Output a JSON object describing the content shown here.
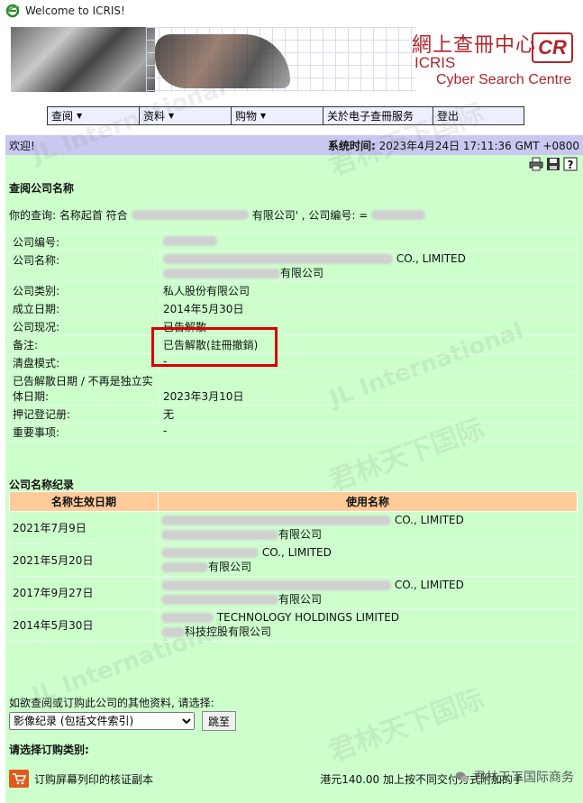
{
  "window": {
    "title": "Welcome to ICRIS!"
  },
  "banner": {
    "cn_logo": "網上查冊中心",
    "cr_mark": "CR",
    "icris": "ICRIS",
    "subtitle": "Cyber Search Centre"
  },
  "menu": [
    {
      "label": "查阅",
      "dropdown": true
    },
    {
      "label": "资料",
      "dropdown": true
    },
    {
      "label": "购物",
      "dropdown": true
    },
    {
      "label": "关於电子查冊服务",
      "dropdown": false
    },
    {
      "label": "登出",
      "dropdown": false
    }
  ],
  "welcome": {
    "greeting": "欢迎!",
    "time_label": "系统时间:",
    "time_value": "2023年4月24日 17:11:36 GMT +0800"
  },
  "search": {
    "title": "查阅公司名称",
    "query_prefix": "你的查询:  名称起首 符合",
    "query_suffix": "有限公司' , 公司编号:  ="
  },
  "company": {
    "rows": [
      {
        "label": "公司编号:",
        "value": ""
      },
      {
        "label": "公司名称:",
        "value": "CO., LIMITED",
        "value2": "有限公司"
      },
      {
        "label": "公司类别:",
        "value": "私人股份有限公司"
      },
      {
        "label": "成立日期:",
        "value": "2014年5月30日"
      },
      {
        "label": "公司现况:",
        "value": "已告解散"
      },
      {
        "label": "备注:",
        "value": "已告解散(註冊撤銷)"
      },
      {
        "label": "清盘模式:",
        "value": "-"
      },
      {
        "label": "已告解散日期 / 不再是独立实体日期:",
        "value": "2023年3月10日"
      },
      {
        "label": "押记登记册:",
        "value": "无"
      },
      {
        "label": "重要事项:",
        "value": "-"
      }
    ]
  },
  "history": {
    "title": "公司名称纪录",
    "headers": [
      "名称生效日期",
      "使用名称"
    ],
    "rows": [
      {
        "date": "2021年7月9日",
        "en": "CO., LIMITED",
        "cn": "有限公司"
      },
      {
        "date": "2021年5月20日",
        "en": "CO., LIMITED",
        "cn": "有限公司"
      },
      {
        "date": "2017年9月27日",
        "en": "CO., LIMITED",
        "cn": "有限公司"
      },
      {
        "date": "2014年5月30日",
        "en": "TECHNOLOGY HOLDINGS LIMITED",
        "cn": "科技控股有限公司"
      }
    ]
  },
  "more": {
    "prompt": "如欲查阅或订购此公司的其他资料, 请选择:",
    "select_value": "影像纪录 (包括文件索引)",
    "go_label": "跳至"
  },
  "order": {
    "title": "请选择订购类别:",
    "item_label": "订购屏幕列印的核证副本",
    "price": "港元140.00 加上按不同交付方式附加的手"
  },
  "watermark": {
    "footer": "君林天下国际商务"
  }
}
